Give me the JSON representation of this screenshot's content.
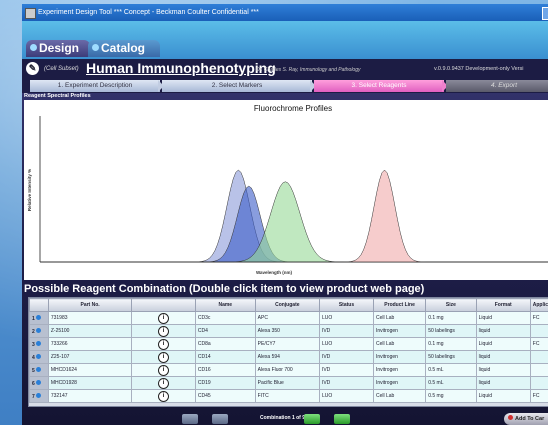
{
  "window": {
    "title": "Experiment Design Tool *** Concept - Beckman Coulter Confidential ***",
    "minimize_label": "_"
  },
  "tabs": [
    {
      "label": "Design"
    },
    {
      "label": "Catalog"
    }
  ],
  "header": {
    "subset_label": "(Cell Subset)",
    "title": "Human Immunophenotyping",
    "author": "Dr. Charles S. Ray, Immunology and Pathology",
    "version": "v.0.9.0.9437 Development-only Versi"
  },
  "steps": [
    {
      "label": "1. Experiment Description"
    },
    {
      "label": "2. Select Markers"
    },
    {
      "label": "3. Select Reagents"
    },
    {
      "label": "4. Export"
    }
  ],
  "section_label": "Reagent Spectral Profiles",
  "chart_data": {
    "type": "area",
    "title": "Fluorochrome Profiles",
    "xlabel": "Wavelength (nm)",
    "ylabel": "Relative Intensity %",
    "series": [
      {
        "color": "#8a9ad8",
        "peak": 0.38,
        "height": 0.63,
        "width": 0.022
      },
      {
        "color": "#3a5cc8",
        "peak": 0.4,
        "height": 0.52,
        "width": 0.022
      },
      {
        "color": "#96d896",
        "peak": 0.47,
        "height": 0.55,
        "width": 0.028
      },
      {
        "color": "#f0aaaa",
        "peak": 0.66,
        "height": 0.63,
        "width": 0.02
      }
    ]
  },
  "combination_header": "Possible Reagent Combination (Double click item to view product web page)",
  "table": {
    "headers": [
      "",
      "Part No.",
      "",
      "Name",
      "Conjugate",
      "Status",
      "Product Line",
      "Size",
      "Format",
      "Application"
    ],
    "rows": [
      {
        "num": "1",
        "part": "731983",
        "name": "CD3c",
        "conjugate": "APC",
        "status": "LUO",
        "line": "Cell Lab",
        "size": "0.1 mg",
        "format": "Liquid",
        "app": "FC"
      },
      {
        "num": "2",
        "part": "Z-25100",
        "name": "CD4",
        "conjugate": "Alexa 350",
        "status": "IVD",
        "line": "Invitrogen",
        "size": "50 labelings",
        "format": "liquid",
        "app": ""
      },
      {
        "num": "3",
        "part": "733266",
        "name": "CD8a",
        "conjugate": "PE/CY7",
        "status": "LUO",
        "line": "Cell Lab",
        "size": "0.1 mg",
        "format": "Liquid",
        "app": "FC"
      },
      {
        "num": "4",
        "part": "Z25-107",
        "name": "CD14",
        "conjugate": "Alexa 594",
        "status": "IVD",
        "line": "Invitrogen",
        "size": "50 labelings",
        "format": "liquid",
        "app": ""
      },
      {
        "num": "5",
        "part": "MHCD1624",
        "name": "CD16",
        "conjugate": "Alexa Fluor 700",
        "status": "IVD",
        "line": "Invitrogen",
        "size": "0.5 mL",
        "format": "liquid",
        "app": ""
      },
      {
        "num": "6",
        "part": "MHCD1928",
        "name": "CD19",
        "conjugate": "Pacific Blue",
        "status": "IVD",
        "line": "Invitrogen",
        "size": "0.5 mL",
        "format": "liquid",
        "app": ""
      },
      {
        "num": "7",
        "part": "732147",
        "name": "CD45",
        "conjugate": "FITC",
        "status": "LUO",
        "line": "Cell Lab",
        "size": "0.5 mg",
        "format": "Liquid",
        "app": "FC"
      }
    ]
  },
  "bottom": {
    "combination_text": "Combination 1 of 9",
    "add_to_cart": "Add To Car"
  }
}
